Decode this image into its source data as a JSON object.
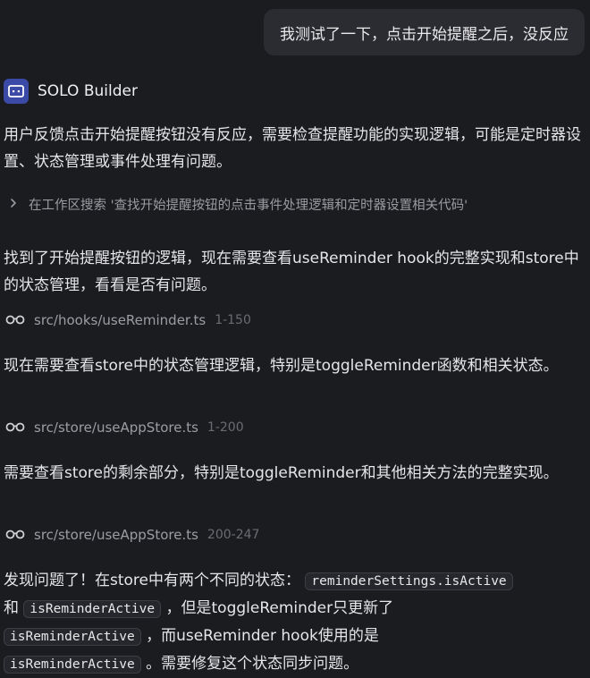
{
  "user_message": "我测试了一下，点击开始提醒之后，没反应",
  "agent": {
    "name": "SOLO Builder",
    "icon": "monitor-icon"
  },
  "messages": {
    "intro": "用户反馈点击开始提醒按钮没有反应，需要检查提醒功能的实现逻辑，可能是定时器设置、状态管理或事件处理有问题。",
    "search_action": "在工作区搜索 '查找开始提醒按钮的点击事件处理逻辑和定时器设置相关代码'",
    "found_text": "找到了开始提醒按钮的逻辑，现在需要查看useReminder hook的完整实现和store中的状态管理，看看是否有问题。",
    "file1": {
      "path": "src/hooks/useReminder.ts",
      "range": "1-150"
    },
    "store_text": "现在需要查看store中的状态管理逻辑，特别是toggleReminder函数和相关状态。",
    "file2": {
      "path": "src/store/useAppStore.ts",
      "range": "1-200"
    },
    "rest_text": "需要查看store的剩余部分，特别是toggleReminder和其他相关方法的完整实现。",
    "file3": {
      "path": "src/store/useAppStore.ts",
      "range": "200-247"
    },
    "final": {
      "t1": "发现问题了！在store中有两个不同的状态：",
      "c1": "reminderSettings.isActive",
      "t2": "和",
      "c2": "isReminderActive",
      "t3": "，但是toggleReminder只更新了",
      "c3": "isReminderActive",
      "t4": "，而useReminder hook使用的是",
      "c4": "isReminderActive",
      "t5": "。需要修复这个状态同步问题。"
    }
  }
}
